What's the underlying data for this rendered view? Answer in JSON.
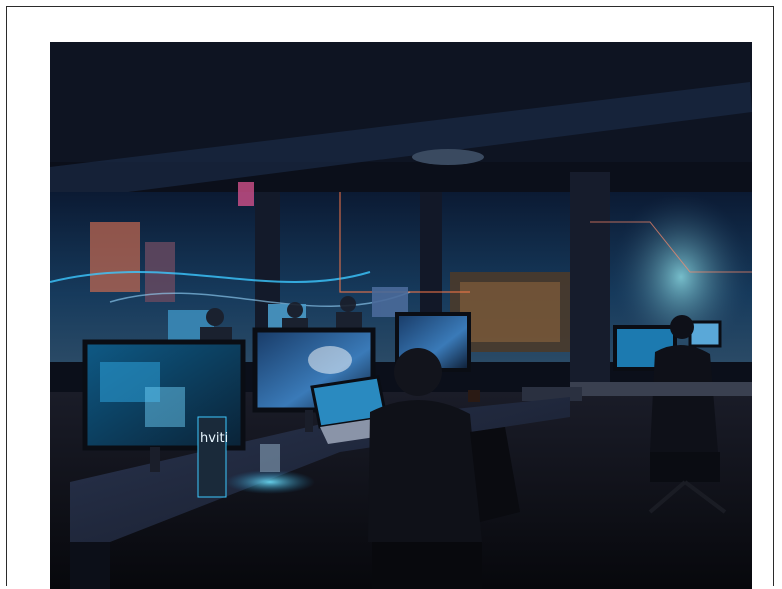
{
  "image": {
    "screen_text": "hviti",
    "colors": {
      "background": "#ffffff",
      "frame": "#2b2b2b",
      "night_sky": "#0b1a33",
      "city_glow": "#f0a050",
      "screen_glow": "#3cc8ff",
      "magenta_accent": "#d0508a",
      "orange_line": "#ff7a4a"
    }
  }
}
